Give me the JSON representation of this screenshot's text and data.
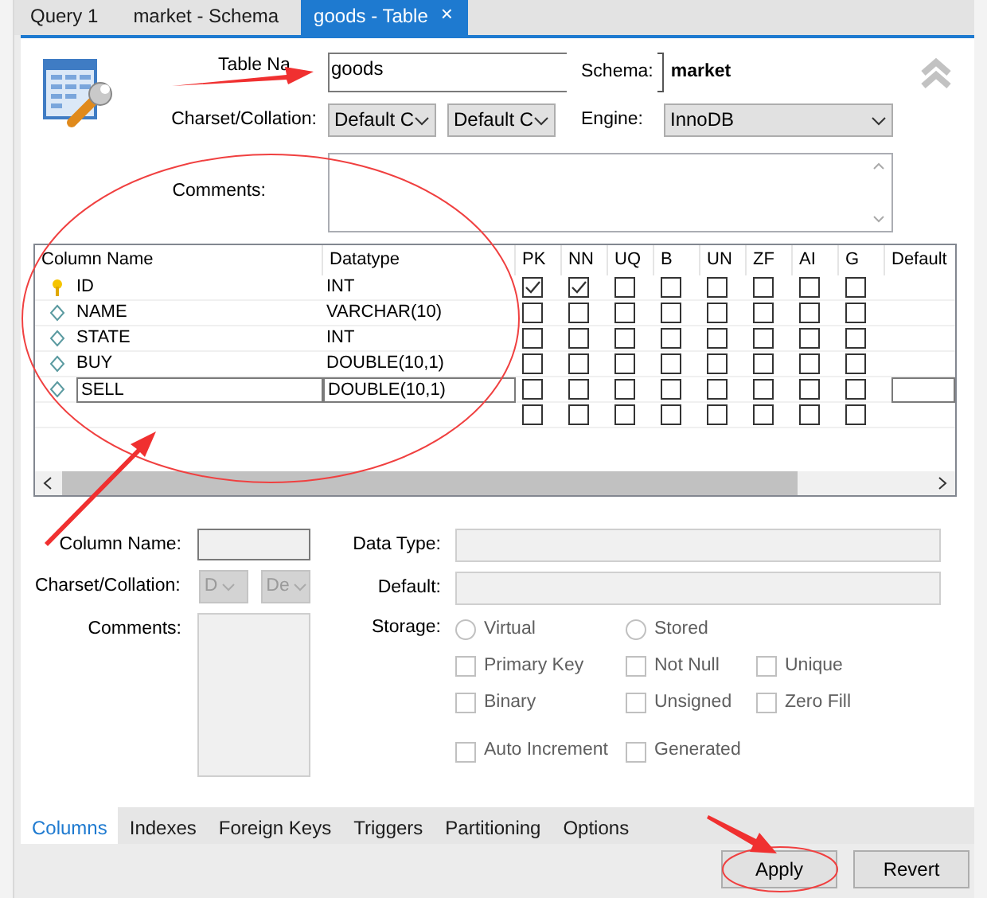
{
  "tabs": [
    {
      "label": "Query 1",
      "selected": false
    },
    {
      "label": "market - Schema",
      "selected": false
    },
    {
      "label": "goods - Table",
      "selected": true,
      "close": "×"
    }
  ],
  "table_name": {
    "label": "Table Na",
    "value": "goods"
  },
  "schema": {
    "label": "Schema:",
    "value": "market"
  },
  "charset": {
    "label": "Charset/Collation:",
    "charset": "Default C",
    "collation": "Default C"
  },
  "engine": {
    "label": "Engine:",
    "value": "InnoDB"
  },
  "comments": {
    "label": "Comments:"
  },
  "grid": {
    "columns": [
      "Column Name",
      "Datatype",
      "PK",
      "NN",
      "UQ",
      "B",
      "UN",
      "ZF",
      "AI",
      "G",
      "Default"
    ],
    "rows": [
      {
        "kind": "column",
        "name": "ID",
        "datatype": "INT",
        "primary_key": true,
        "editing": false,
        "checks": [
          true,
          true,
          false,
          false,
          false,
          false,
          false,
          false
        ]
      },
      {
        "kind": "column",
        "name": "NAME",
        "datatype": "VARCHAR(10)",
        "primary_key": false,
        "editing": false,
        "checks": [
          false,
          false,
          false,
          false,
          false,
          false,
          false,
          false
        ]
      },
      {
        "kind": "column",
        "name": "STATE",
        "datatype": "INT",
        "primary_key": false,
        "editing": false,
        "checks": [
          false,
          false,
          false,
          false,
          false,
          false,
          false,
          false
        ]
      },
      {
        "kind": "column",
        "name": "BUY",
        "datatype": "DOUBLE(10,1)",
        "primary_key": false,
        "editing": false,
        "checks": [
          false,
          false,
          false,
          false,
          false,
          false,
          false,
          false
        ]
      },
      {
        "kind": "column",
        "name": "SELL",
        "datatype": "DOUBLE(10,1)",
        "primary_key": false,
        "editing": true,
        "checks": [
          false,
          false,
          false,
          false,
          false,
          false,
          false,
          false
        ]
      },
      {
        "kind": "new",
        "checks": [
          false,
          false,
          false,
          false,
          false,
          false,
          false,
          false
        ]
      }
    ]
  },
  "column_details": {
    "disabled": true,
    "column_name": {
      "label": "Column Name:"
    },
    "charset": {
      "label": "Charset/Collation:",
      "charset": "D",
      "collation": "De"
    },
    "comments": {
      "label": "Comments:"
    },
    "data_type": {
      "label": "Data Type:"
    },
    "default": {
      "label": "Default:"
    },
    "storage": {
      "label": "Storage:"
    },
    "options": [
      {
        "kind": "radio",
        "label": "Virtual",
        "checked": false
      },
      {
        "kind": "radio",
        "label": "Stored",
        "checked": false
      },
      {
        "kind": "spacer"
      },
      {
        "kind": "checkbox",
        "label": "Primary Key",
        "checked": false
      },
      {
        "kind": "checkbox",
        "label": "Not Null",
        "checked": false
      },
      {
        "kind": "checkbox",
        "label": "Unique",
        "checked": false
      },
      {
        "kind": "checkbox",
        "label": "Binary",
        "checked": false
      },
      {
        "kind": "checkbox",
        "label": "Unsigned",
        "checked": false
      },
      {
        "kind": "checkbox",
        "label": "Zero Fill",
        "checked": false
      },
      {
        "kind": "checkbox",
        "label": "Auto Increment",
        "checked": false
      },
      {
        "kind": "checkbox",
        "label": "Generated",
        "checked": false
      }
    ]
  },
  "bottom_tabs": [
    {
      "label": "Columns",
      "selected": true
    },
    {
      "label": "Indexes",
      "selected": false
    },
    {
      "label": "Foreign Keys",
      "selected": false
    },
    {
      "label": "Triggers",
      "selected": false
    },
    {
      "label": "Partitioning",
      "selected": false
    },
    {
      "label": "Options",
      "selected": false
    }
  ],
  "buttons": [
    "Apply",
    "Revert"
  ]
}
